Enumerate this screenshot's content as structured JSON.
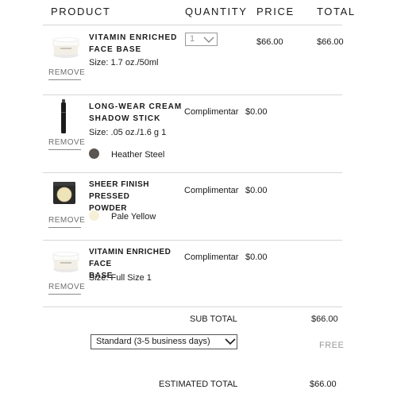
{
  "header": {
    "product": "PRODUCT",
    "quantity": "QUANTITY",
    "price": "PRICE",
    "total": "TOTAL"
  },
  "items": [
    {
      "name_line1": "VITAMIN ENRICHED",
      "name_line2": "FACE BASE",
      "size": "Size: 1.7 oz./50ml",
      "remove": "REMOVE",
      "quantity": "1",
      "price": "$66.00",
      "total": "$66.00",
      "icon": "face-base-jar-icon"
    },
    {
      "name_line1": "LONG-WEAR CREAM",
      "name_line2": "SHADOW STICK",
      "size": "Size: .05 oz./1.6 g 1",
      "shade": "Heather Steel",
      "shade_color": "#5a5551",
      "remove": "REMOVE",
      "quantity_text": "Complimentar",
      "price": "$0.00",
      "icon": "shadow-stick-icon"
    },
    {
      "name_line1": "SHEER FINISH PRESSED",
      "name_line2": "POWDER",
      "shade": "Pale Yellow",
      "shade_color": "#f6f0d6",
      "remove": "REMOVE",
      "quantity_text": "Complimentar",
      "price": "$0.00",
      "icon": "pressed-powder-compact-icon"
    },
    {
      "name_line1": "VITAMIN ENRICHED FACE",
      "name_line2": "BASE",
      "size": "Size: Full Size 1",
      "remove": "REMOVE",
      "quantity_text": "Complimentar",
      "price": "$0.00",
      "icon": "face-base-jar-icon"
    }
  ],
  "summary": {
    "subtotal_label": "SUB TOTAL",
    "subtotal_value": "$66.00",
    "shipping_option": "Standard (3-5 business days)",
    "shipping_value": "FREE",
    "estimated_total_label": "ESTIMATED TOTAL",
    "estimated_total_value": "$66.00"
  }
}
